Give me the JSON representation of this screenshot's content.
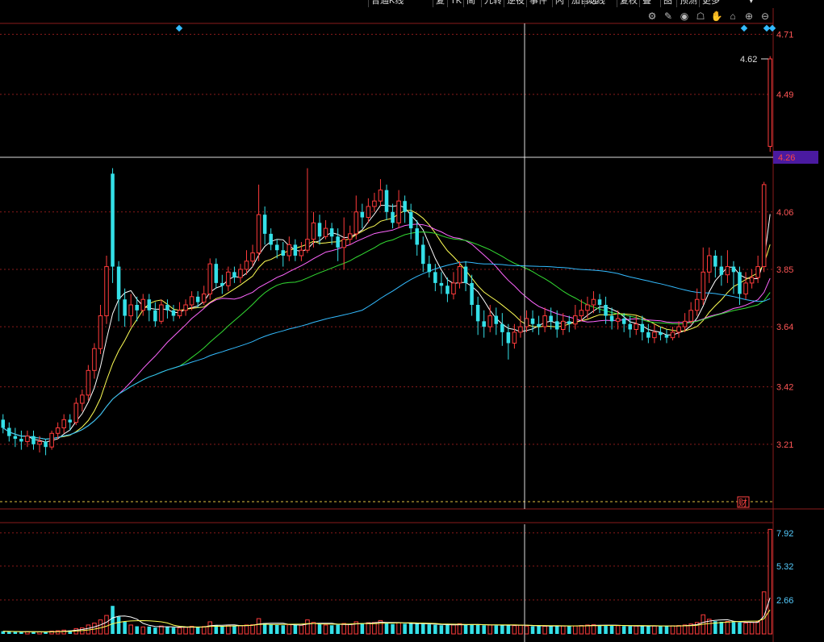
{
  "toolbar": {
    "items": [
      "普通K线",
      "复",
      "TK",
      "简",
      "九转",
      "逆夜",
      "事件",
      "闪",
      "加自选",
      "均线",
      "复权",
      "叠",
      "图",
      "预测",
      "更多"
    ]
  },
  "icons": [
    "gear-icon",
    "draw-icon",
    "eye-icon",
    "lock-icon",
    "hand-icon",
    "home-icon",
    "zoom-in-icon",
    "zoom-out-icon"
  ],
  "colors": {
    "up": "#ff3b3b",
    "down": "#34e0e8",
    "ma5": "#ffffff",
    "ma10": "#ffff55",
    "ma20": "#ff66ff",
    "ma30": "#33dd33",
    "ma60": "#33bbff",
    "crosshair_label_bg": "#4a1aa0",
    "grid": "#8a1b1b"
  },
  "chart_data": [
    {
      "type": "candlestick",
      "panel": "price",
      "y_ticks": [
        "4.71",
        "4.49",
        "3.85",
        "3.64",
        "3.42",
        "3.21",
        "4.06"
      ],
      "ylim": [
        3.0,
        4.8
      ],
      "max_label": "4.62",
      "crosshair_price": "4.26",
      "marker": "财",
      "candles": [
        [
          3.3,
          3.27,
          3.32,
          3.25
        ],
        [
          3.27,
          3.24,
          3.29,
          3.22
        ],
        [
          3.24,
          3.23,
          3.27,
          3.2
        ],
        [
          3.23,
          3.22,
          3.26,
          3.19
        ],
        [
          3.22,
          3.24,
          3.26,
          3.2
        ],
        [
          3.24,
          3.21,
          3.26,
          3.19
        ],
        [
          3.21,
          3.22,
          3.24,
          3.18
        ],
        [
          3.22,
          3.2,
          3.23,
          3.17
        ],
        [
          3.2,
          3.25,
          3.26,
          3.19
        ],
        [
          3.25,
          3.27,
          3.29,
          3.23
        ],
        [
          3.27,
          3.3,
          3.32,
          3.25
        ],
        [
          3.3,
          3.29,
          3.32,
          3.26
        ],
        [
          3.29,
          3.36,
          3.38,
          3.28
        ],
        [
          3.36,
          3.39,
          3.41,
          3.33
        ],
        [
          3.39,
          3.48,
          3.5,
          3.37
        ],
        [
          3.48,
          3.56,
          3.58,
          3.45
        ],
        [
          3.56,
          3.68,
          3.72,
          3.54
        ],
        [
          3.68,
          3.86,
          3.9,
          3.65
        ],
        [
          4.2,
          3.86,
          4.22,
          3.8
        ],
        [
          3.86,
          3.74,
          3.88,
          3.66
        ],
        [
          3.74,
          3.68,
          3.78,
          3.64
        ],
        [
          3.68,
          3.72,
          3.76,
          3.64
        ],
        [
          3.72,
          3.7,
          3.75,
          3.66
        ],
        [
          3.7,
          3.74,
          3.76,
          3.68
        ],
        [
          3.74,
          3.7,
          3.76,
          3.66
        ],
        [
          3.7,
          3.66,
          3.73,
          3.64
        ],
        [
          3.66,
          3.72,
          3.74,
          3.65
        ],
        [
          3.72,
          3.7,
          3.74,
          3.67
        ],
        [
          3.7,
          3.68,
          3.72,
          3.66
        ],
        [
          3.68,
          3.7,
          3.73,
          3.67
        ],
        [
          3.7,
          3.72,
          3.74,
          3.68
        ],
        [
          3.72,
          3.75,
          3.77,
          3.7
        ],
        [
          3.75,
          3.73,
          3.77,
          3.71
        ],
        [
          3.73,
          3.76,
          3.79,
          3.72
        ],
        [
          3.76,
          3.87,
          3.89,
          3.74
        ],
        [
          3.87,
          3.8,
          3.89,
          3.78
        ],
        [
          3.8,
          3.79,
          3.83,
          3.76
        ],
        [
          3.79,
          3.84,
          3.86,
          3.77
        ],
        [
          3.84,
          3.82,
          3.86,
          3.8
        ],
        [
          3.82,
          3.85,
          3.87,
          3.8
        ],
        [
          3.85,
          3.88,
          3.92,
          3.83
        ],
        [
          3.88,
          3.91,
          3.94,
          3.86
        ],
        [
          3.91,
          4.05,
          4.16,
          3.88
        ],
        [
          4.05,
          3.98,
          4.08,
          3.94
        ],
        [
          3.98,
          3.94,
          4.0,
          3.92
        ],
        [
          3.94,
          3.92,
          3.96,
          3.89
        ],
        [
          3.92,
          3.9,
          3.95,
          3.86
        ],
        [
          3.9,
          3.94,
          3.97,
          3.88
        ],
        [
          3.94,
          3.9,
          3.96,
          3.88
        ],
        [
          3.9,
          3.92,
          3.95,
          3.88
        ],
        [
          3.92,
          3.96,
          4.22,
          3.91
        ],
        [
          3.96,
          4.02,
          4.06,
          3.93
        ],
        [
          4.02,
          3.97,
          4.05,
          3.94
        ],
        [
          3.97,
          4.0,
          4.03,
          3.96
        ],
        [
          4.0,
          3.97,
          4.02,
          3.94
        ],
        [
          3.97,
          3.93,
          4.0,
          3.88
        ],
        [
          3.93,
          3.96,
          4.04,
          3.85
        ],
        [
          3.96,
          3.98,
          4.01,
          3.94
        ],
        [
          3.98,
          4.06,
          4.12,
          3.96
        ],
        [
          4.06,
          4.04,
          4.09,
          4.0
        ],
        [
          4.04,
          4.08,
          4.11,
          4.02
        ],
        [
          4.08,
          4.1,
          4.13,
          4.06
        ],
        [
          4.1,
          4.14,
          4.18,
          4.08
        ],
        [
          4.14,
          4.06,
          4.16,
          4.03
        ],
        [
          4.06,
          4.02,
          4.09,
          4.0
        ],
        [
          4.02,
          4.1,
          4.14,
          4.0
        ],
        [
          4.1,
          4.06,
          4.12,
          4.02
        ],
        [
          4.06,
          4.0,
          4.09,
          3.96
        ],
        [
          4.0,
          3.94,
          4.03,
          3.9
        ],
        [
          3.94,
          3.87,
          3.97,
          3.84
        ],
        [
          3.87,
          3.84,
          3.9,
          3.82
        ],
        [
          3.84,
          3.8,
          3.87,
          3.77
        ],
        [
          3.8,
          3.79,
          3.84,
          3.76
        ],
        [
          3.79,
          3.76,
          3.82,
          3.73
        ],
        [
          3.76,
          3.8,
          3.84,
          3.74
        ],
        [
          3.8,
          3.86,
          3.88,
          3.78
        ],
        [
          3.86,
          3.8,
          3.88,
          3.77
        ],
        [
          3.8,
          3.72,
          3.83,
          3.68
        ],
        [
          3.72,
          3.66,
          3.75,
          3.61
        ],
        [
          3.66,
          3.64,
          3.7,
          3.6
        ],
        [
          3.64,
          3.68,
          3.72,
          3.62
        ],
        [
          3.68,
          3.65,
          3.71,
          3.61
        ],
        [
          3.65,
          3.62,
          3.69,
          3.57
        ],
        [
          3.62,
          3.58,
          3.65,
          3.52
        ],
        [
          3.58,
          3.62,
          3.65,
          3.56
        ],
        [
          3.62,
          3.64,
          3.68,
          3.6
        ],
        [
          3.64,
          3.67,
          3.7,
          3.62
        ],
        [
          3.67,
          3.65,
          3.7,
          3.62
        ],
        [
          3.65,
          3.64,
          3.68,
          3.61
        ],
        [
          3.64,
          3.68,
          3.71,
          3.62
        ],
        [
          3.68,
          3.66,
          3.71,
          3.63
        ],
        [
          3.66,
          3.63,
          3.7,
          3.6
        ],
        [
          3.63,
          3.66,
          3.69,
          3.61
        ],
        [
          3.66,
          3.65,
          3.68,
          3.62
        ],
        [
          3.65,
          3.68,
          3.72,
          3.63
        ],
        [
          3.68,
          3.7,
          3.74,
          3.66
        ],
        [
          3.7,
          3.72,
          3.75,
          3.67
        ],
        [
          3.72,
          3.74,
          3.77,
          3.69
        ],
        [
          3.74,
          3.72,
          3.76,
          3.69
        ],
        [
          3.72,
          3.68,
          3.75,
          3.65
        ],
        [
          3.68,
          3.66,
          3.71,
          3.63
        ],
        [
          3.66,
          3.67,
          3.7,
          3.63
        ],
        [
          3.67,
          3.65,
          3.69,
          3.62
        ],
        [
          3.65,
          3.63,
          3.68,
          3.6
        ],
        [
          3.63,
          3.65,
          3.68,
          3.61
        ],
        [
          3.65,
          3.62,
          3.68,
          3.59
        ],
        [
          3.62,
          3.6,
          3.65,
          3.58
        ],
        [
          3.6,
          3.62,
          3.65,
          3.58
        ],
        [
          3.62,
          3.61,
          3.64,
          3.59
        ],
        [
          3.61,
          3.6,
          3.63,
          3.58
        ],
        [
          3.6,
          3.62,
          3.64,
          3.59
        ],
        [
          3.62,
          3.64,
          3.66,
          3.6
        ],
        [
          3.64,
          3.66,
          3.69,
          3.62
        ],
        [
          3.66,
          3.7,
          3.73,
          3.65
        ],
        [
          3.7,
          3.74,
          3.78,
          3.68
        ],
        [
          3.74,
          3.84,
          3.93,
          3.72
        ],
        [
          3.84,
          3.9,
          3.93,
          3.8
        ],
        [
          3.9,
          3.86,
          3.92,
          3.82
        ],
        [
          3.86,
          3.83,
          3.9,
          3.79
        ],
        [
          3.83,
          3.86,
          3.92,
          3.8
        ],
        [
          3.86,
          3.84,
          3.88,
          3.76
        ],
        [
          3.84,
          3.76,
          3.86,
          3.72
        ],
        [
          3.76,
          3.8,
          3.84,
          3.74
        ],
        [
          3.8,
          3.82,
          3.85,
          3.78
        ],
        [
          3.82,
          3.86,
          3.9,
          3.8
        ],
        [
          3.86,
          4.16,
          4.17,
          3.84
        ],
        [
          4.3,
          4.62,
          4.63,
          4.28
        ]
      ]
    },
    {
      "type": "bar",
      "panel": "volume",
      "y_ticks": [
        "7.92",
        "5.32",
        "2.66"
      ],
      "ylim": [
        0,
        8.6
      ],
      "values": [
        0.21,
        0.18,
        0.17,
        0.16,
        0.18,
        0.15,
        0.16,
        0.14,
        0.22,
        0.25,
        0.3,
        0.28,
        0.42,
        0.48,
        0.7,
        0.85,
        1.1,
        1.45,
        2.2,
        1.35,
        0.95,
        0.7,
        0.6,
        0.55,
        0.58,
        0.5,
        0.62,
        0.55,
        0.5,
        0.48,
        0.52,
        0.6,
        0.55,
        0.58,
        0.95,
        0.7,
        0.6,
        0.68,
        0.62,
        0.65,
        0.7,
        0.72,
        1.2,
        0.85,
        0.75,
        0.7,
        0.68,
        0.72,
        0.7,
        0.68,
        1.1,
        0.9,
        0.78,
        0.7,
        0.68,
        0.72,
        0.82,
        0.75,
        0.95,
        0.85,
        0.88,
        0.9,
        1.05,
        0.85,
        0.78,
        0.88,
        0.8,
        0.82,
        0.8,
        0.78,
        0.75,
        0.72,
        0.68,
        0.7,
        0.72,
        0.8,
        0.7,
        0.75,
        0.72,
        0.68,
        0.7,
        0.66,
        0.7,
        0.72,
        0.65,
        0.68,
        0.62,
        0.6,
        0.64,
        0.6,
        0.62,
        0.66,
        0.62,
        0.64,
        0.62,
        0.66,
        0.7,
        0.72,
        0.7,
        0.68,
        0.66,
        0.64,
        0.62,
        0.6,
        0.62,
        0.64,
        0.66,
        0.62,
        0.6,
        0.62,
        0.64,
        0.66,
        0.7,
        0.78,
        0.9,
        1.5,
        1.15,
        1.0,
        0.95,
        0.98,
        0.92,
        0.9,
        0.86,
        0.9,
        0.95,
        3.3,
        8.2
      ]
    }
  ]
}
